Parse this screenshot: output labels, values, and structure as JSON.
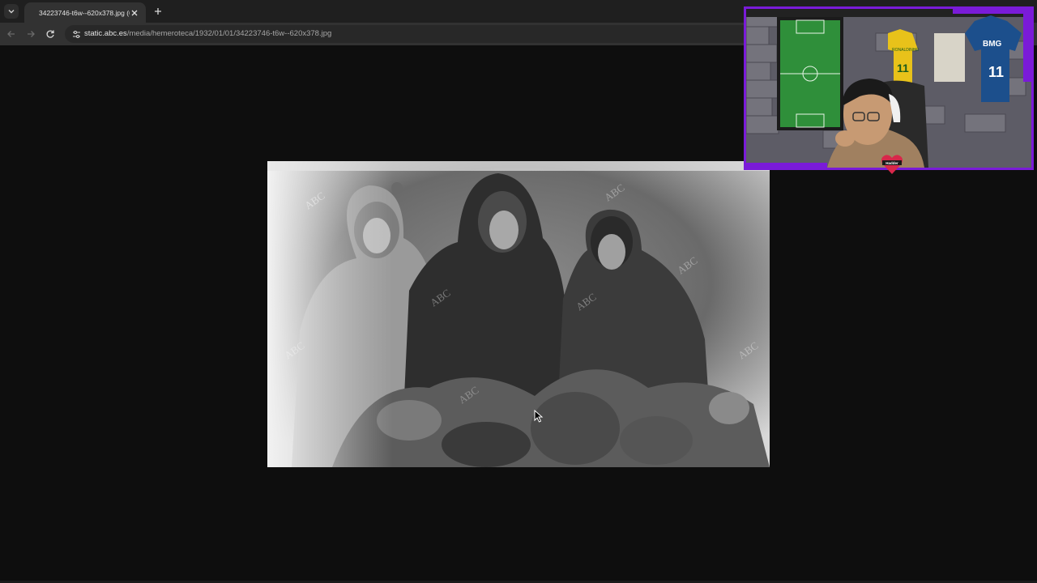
{
  "browser": {
    "tab": {
      "title": "34223746-t6w--620x378.jpg (6…"
    },
    "address": {
      "domain": "static.abc.es",
      "path": "/media/hemeroteca/1932/01/01/34223746-t6w--620x378.jpg"
    }
  },
  "photo": {
    "watermark": "ABC"
  },
  "webcam": {
    "jerseys": [
      {
        "text": "RONALDINHO",
        "number": "11"
      },
      {
        "text": "BMG",
        "number": "11"
      }
    ],
    "badge": "Hadder"
  },
  "colors": {
    "chrome_tabbar": "#1f1f1f",
    "chrome_toolbar": "#323232",
    "page_background": "#0e0e0e",
    "stream_frame": "#7a1bd8"
  }
}
